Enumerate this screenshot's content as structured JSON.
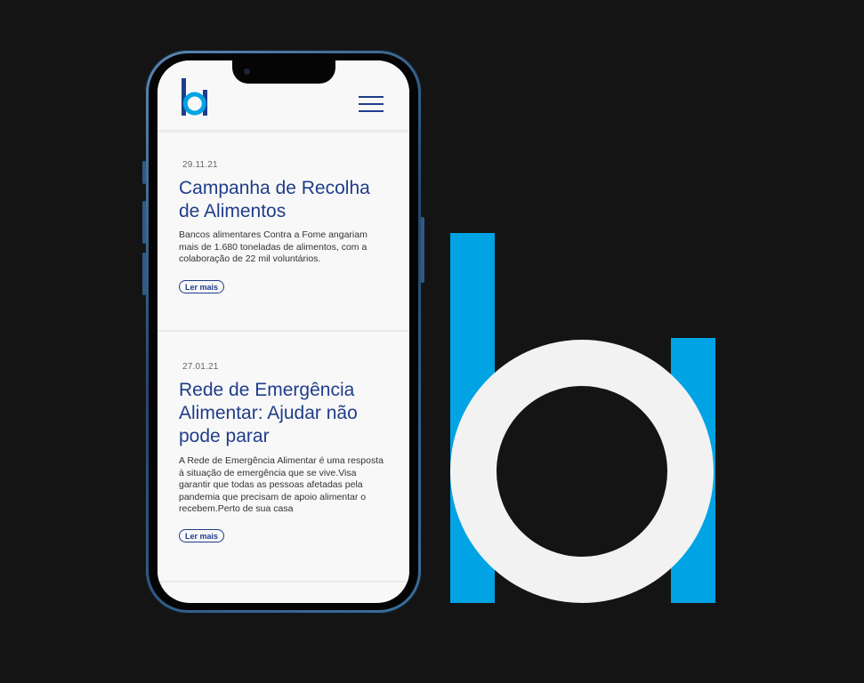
{
  "brand": {
    "primary_color": "#1f3d8a",
    "accent_color": "#00a3e4",
    "logo_icon": "ba-logo-icon"
  },
  "header": {
    "menu_icon": "hamburger-menu-icon"
  },
  "articles": [
    {
      "date": "29.11.21",
      "title": "Campanha de Recolha de Alimentos",
      "excerpt": "Bancos alimentares Contra a Fome angariam mais de 1.680 toneladas de alimentos, com a colaboração de 22 mil voluntários.",
      "cta": "Ler mais"
    },
    {
      "date": "27.01.21",
      "title": "Rede de Emergência Alimentar: Ajudar não pode parar",
      "excerpt": "A Rede de Emergência Alimentar é uma resposta à situação de emergência que se vive.Visa garantir que todas as pessoas afetadas pela pandemia que precisam de apoio alimentar o recebem.Perto de sua casa",
      "cta": "Ler mais"
    }
  ]
}
